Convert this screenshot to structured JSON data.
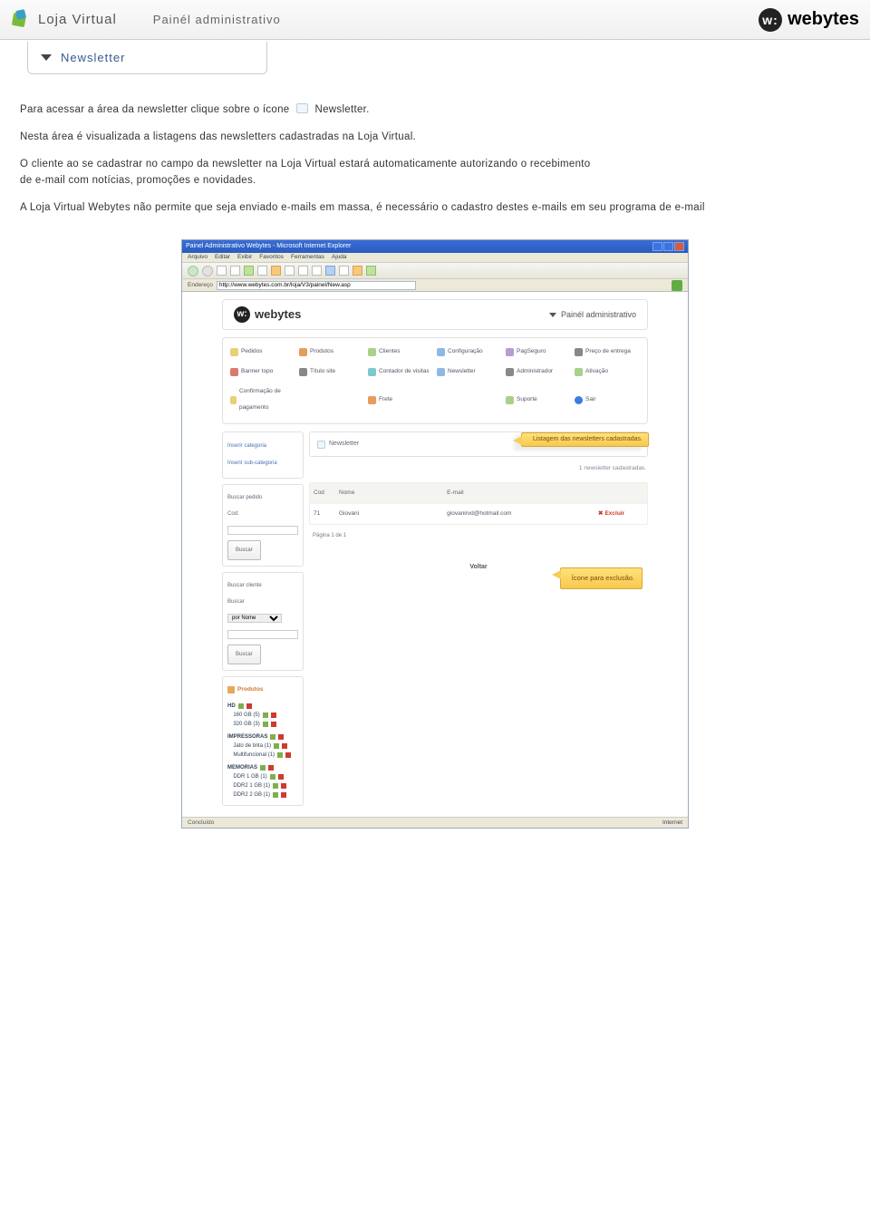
{
  "header": {
    "lv": "Loja Virtual",
    "painel": "Painél administrativo",
    "brand": "webytes",
    "brand_w": "w:"
  },
  "crumb": {
    "title": "Newsletter"
  },
  "para": {
    "p1_a": "Para acessar a área da newsletter clique sobre o ícone",
    "p1_b": "Newsletter.",
    "p2": "Nesta área é visualizada a listagens das newsletters cadastradas na Loja Virtual.",
    "p3a": "O cliente ao se cadastrar no campo da newsletter na Loja Virtual estará automaticamente autorizando o recebimento",
    "p3b": "de e-mail com notícias, promoções e novidades.",
    "p4": "A Loja Virtual Webytes não permite que seja enviado e-mails em massa, é necessário o cadastro destes e-mails em seu programa de e-mail"
  },
  "ie": {
    "title": "Painel Administrativo Webytes - Microsoft Internet Explorer",
    "menus": [
      "Arquivo",
      "Editar",
      "Exibir",
      "Favoritos",
      "Ferramentas",
      "Ajuda"
    ],
    "addr_label": "Endereço",
    "addr_value": "http://www.webytes.com.br/loja/V3/painel/New.asp",
    "status_left": "Concluído",
    "status_right": "Internet"
  },
  "panel": {
    "brand": "webytes",
    "brand_w": "w:",
    "painel": "Painél administrativo",
    "menu": [
      {
        "t": "Pedidos",
        "c": "y"
      },
      {
        "t": "Produtos",
        "c": "o"
      },
      {
        "t": "Clientes",
        "c": "g"
      },
      {
        "t": "Configuração",
        "c": "b"
      },
      {
        "t": "PagSeguro",
        "c": "p"
      },
      {
        "t": "Preço de entrega",
        "c": "k"
      },
      {
        "t": "Banner topo",
        "c": "r"
      },
      {
        "t": "Título site",
        "c": "k"
      },
      {
        "t": "Contador de visitas",
        "c": "c"
      },
      {
        "t": "Newsletter",
        "c": "b"
      },
      {
        "t": "Administrador",
        "c": "k"
      },
      {
        "t": "Ativação",
        "c": "g"
      },
      {
        "t": "Confirmação de pagamento",
        "c": "y"
      },
      {
        "t": "",
        "c": ""
      },
      {
        "t": "Frete",
        "c": "o"
      },
      {
        "t": "",
        "c": ""
      },
      {
        "t": "Suporte",
        "c": "g"
      },
      {
        "t": "Sair",
        "c": "bl"
      }
    ]
  },
  "side": {
    "box1": {
      "l1": "Inserir categoria",
      "l2": "Inserir sub-categoria"
    },
    "box2": {
      "title": "Buscar pedido",
      "lab": "Cod:",
      "btn": "Buscar"
    },
    "box3": {
      "title": "Buscar cliente",
      "lab": "Buscar",
      "sel": "por Nome",
      "btn": "Buscar"
    },
    "box4": {
      "hdr": "Produtos",
      "cats": [
        {
          "n": "HD",
          "sub": [
            "160 GB (5)",
            "320 GB (3)"
          ]
        },
        {
          "n": "IMPRESSORAS",
          "sub": [
            "Jato de tinta (1)",
            "Multifuncional (1)"
          ]
        },
        {
          "n": "MEMORIAS",
          "sub": [
            "DDR 1 GB (1)",
            "DDR2 1 GB (1)",
            "DDR2 2 GB (1)"
          ]
        }
      ]
    }
  },
  "main": {
    "tab": "Newsletter",
    "callout1": "Listagem das newsletters cadastradas.",
    "count": "1 newsletter cadastradas.",
    "thead": {
      "c1": "Cod",
      "c2": "Nome",
      "c3": "E-mail",
      "c4": ""
    },
    "row": {
      "c1": "71",
      "c2": "Giovani",
      "c3": "giovanirvd@hotmail.com",
      "c4": "Excluir"
    },
    "pager": "Página 1 de 1",
    "footer": "Voltar",
    "callout2": "Ícone para exclusão."
  }
}
